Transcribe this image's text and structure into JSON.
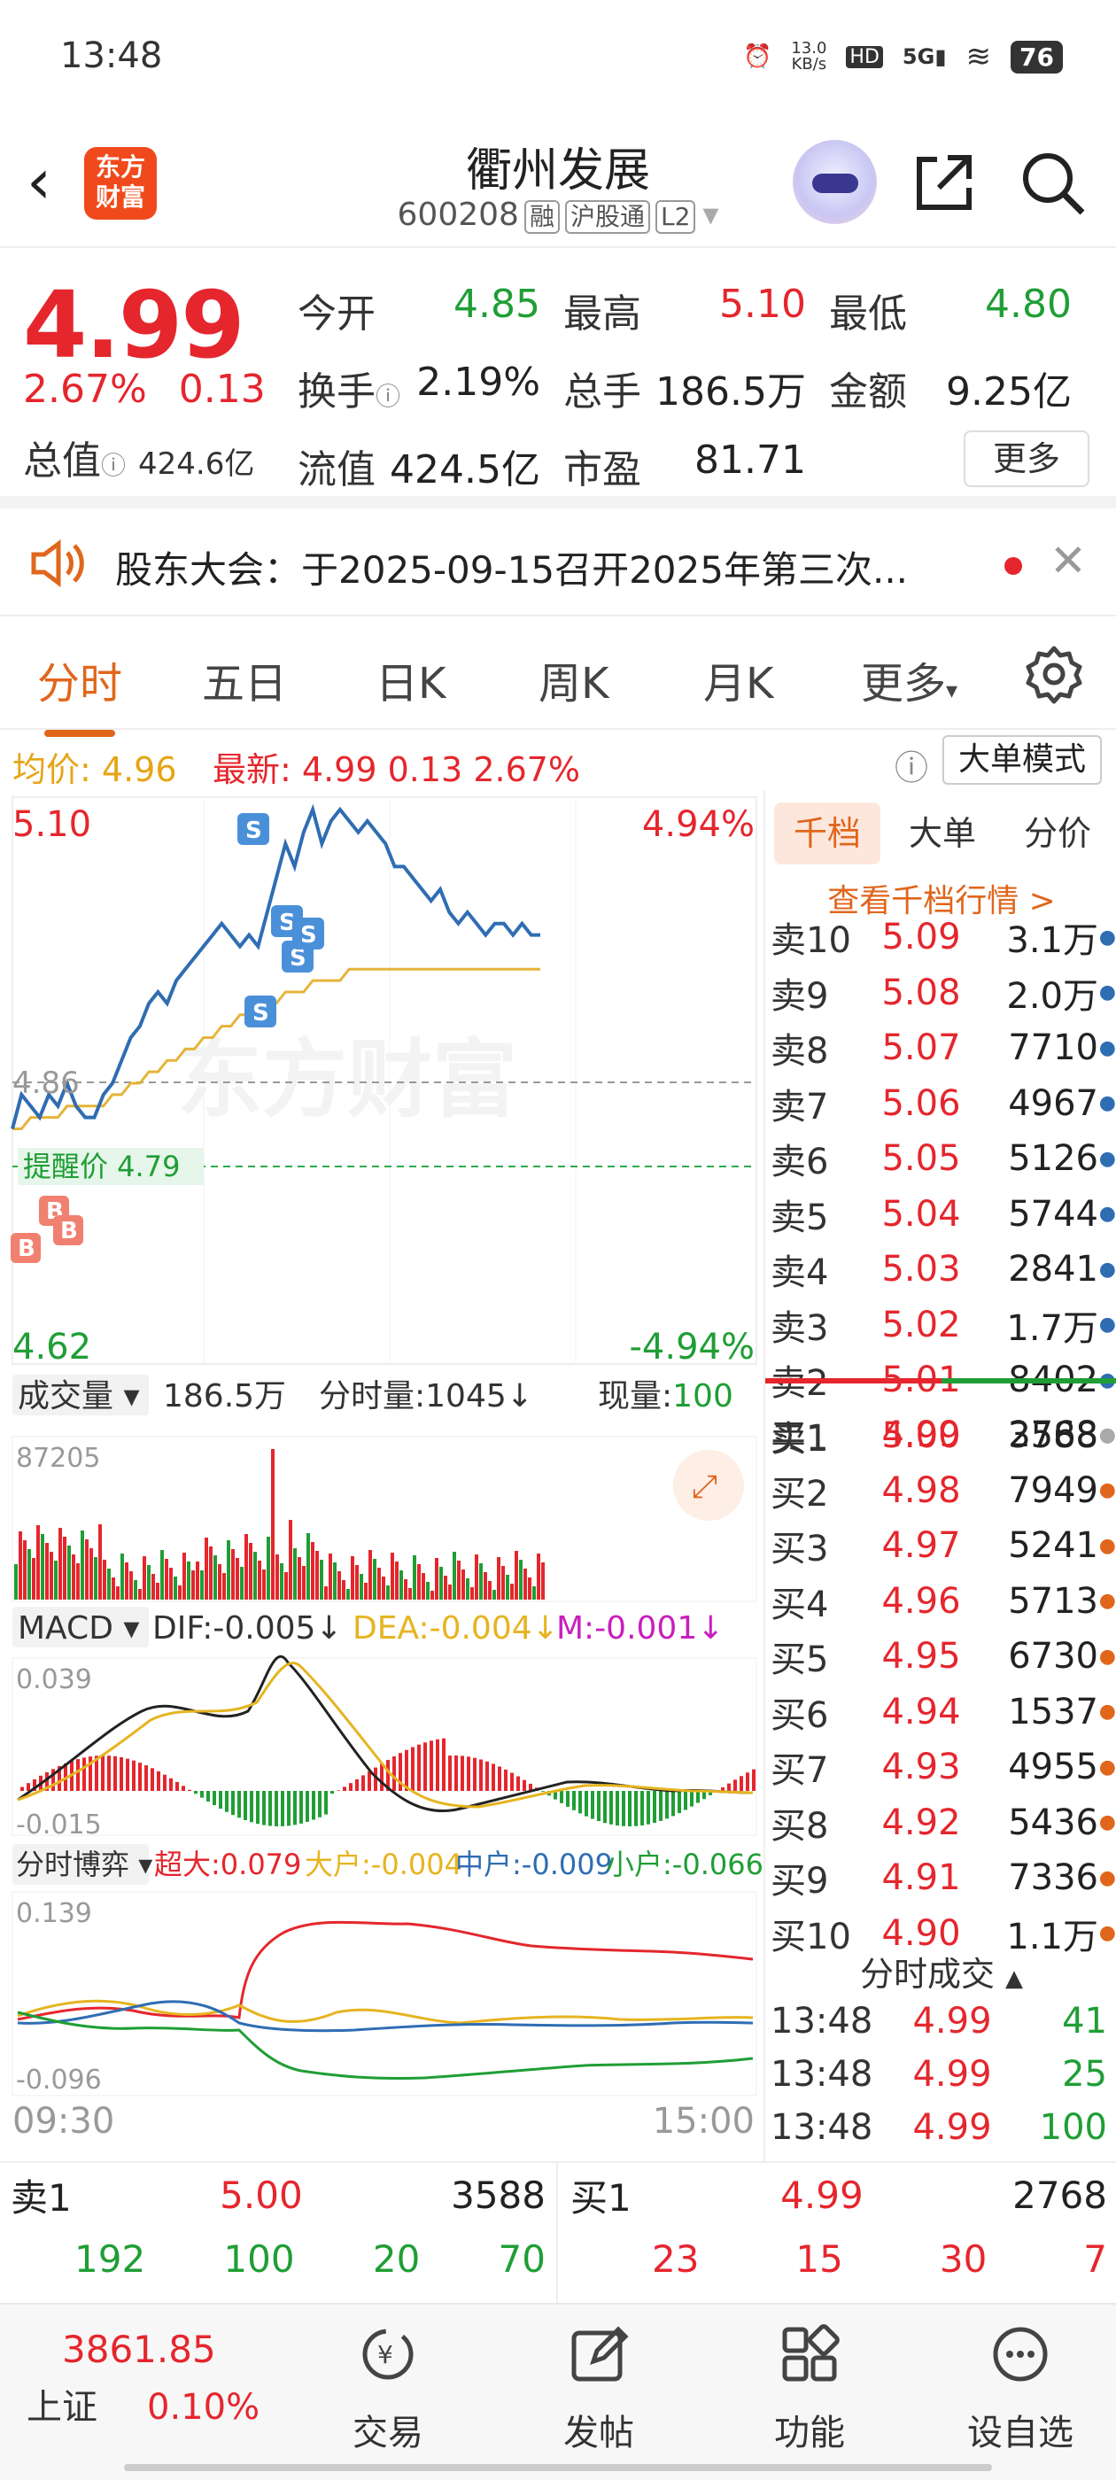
{
  "status": {
    "time": "13:48",
    "speed": "13.0",
    "speed_unit": "KB/s",
    "net": "5G",
    "hd": "HD",
    "battery": "76"
  },
  "header": {
    "logo_line1": "东方",
    "logo_line2": "财富",
    "title": "衢州发展",
    "code": "600208",
    "tags": [
      "融",
      "沪股通",
      "L2"
    ]
  },
  "quote": {
    "price": "4.99",
    "change_pct": "2.67%",
    "change": "0.13",
    "total_mv_label": "总值",
    "total_mv": "424.6亿",
    "rows": [
      [
        {
          "label": "今开",
          "value": "4.85",
          "color": "green"
        },
        {
          "label": "最高",
          "value": "5.10",
          "color": "red"
        },
        {
          "label": "最低",
          "value": "4.80",
          "color": "green"
        }
      ],
      [
        {
          "label": "换手",
          "value": "2.19%",
          "color": "dark"
        },
        {
          "label": "总手",
          "value": "186.5万",
          "color": "dark"
        },
        {
          "label": "金额",
          "value": "9.25亿",
          "color": "dark"
        }
      ],
      [
        {
          "label": "流值",
          "value": "424.5亿",
          "color": "dark"
        },
        {
          "label": "市盈",
          "value": "81.71",
          "color": "dark"
        }
      ]
    ],
    "more_label": "更多"
  },
  "notice": {
    "text": "股东大会：于2025-09-15召开2025年第三次..."
  },
  "tabs": [
    "分时",
    "五日",
    "日K",
    "周K",
    "月K",
    "更多"
  ],
  "infobar": {
    "avg_label": "均价:",
    "avg": "4.96",
    "latest_label": "最新:",
    "latest": "4.99",
    "chg": "0.13",
    "pct": "2.67%",
    "bigorder_label": "大单模式"
  },
  "chart": {
    "price_high": "5.10",
    "price_low": "4.62",
    "pct_high": "4.94%",
    "pct_low": "-4.94%",
    "preclose": "4.86",
    "watermark": "东方财富",
    "alert_label": "提醒价 4.79",
    "vol_label": "成交量",
    "vol_total": "186.5万",
    "vol_seg_label": "分时量:1045↓",
    "vol_now_label": "现量:",
    "vol_now": "100",
    "vol_max": "87205",
    "macd_label": "MACD",
    "dif": "DIF:-0.005↓",
    "dea": "DEA:-0.004↓",
    "m": "M:-0.001↓",
    "macd_top": "0.039",
    "macd_bottom": "-0.015",
    "game_label": "分时博弈",
    "super": "超大:0.079",
    "big": "大户:-0.004",
    "mid": "中户:-0.009",
    "small": "小户:-0.066",
    "game_top": "0.139",
    "game_bottom": "-0.096",
    "t_start": "09:30",
    "t_end": "15:00"
  },
  "chart_data": {
    "type": "line",
    "title": "",
    "price_series": [
      4.82,
      4.85,
      4.84,
      4.83,
      4.85,
      4.84,
      4.86,
      4.84,
      4.83,
      4.83,
      4.85,
      4.86,
      4.88,
      4.9,
      4.91,
      4.93,
      4.94,
      4.93,
      4.95,
      4.96,
      4.97,
      4.98,
      4.99,
      5.0,
      4.99,
      4.98,
      4.99,
      4.98,
      5.01,
      5.04,
      5.07,
      5.05,
      5.08,
      5.1,
      5.07,
      5.09,
      5.1,
      5.09,
      5.08,
      5.09,
      5.08,
      5.07,
      5.05,
      5.05,
      5.04,
      5.03,
      5.02,
      5.03,
      5.01,
      5.0,
      5.01,
      5.0,
      4.99,
      5.0,
      5.0,
      4.99,
      5.0,
      4.99,
      4.99
    ],
    "avg_series": [
      4.82,
      4.82,
      4.83,
      4.83,
      4.83,
      4.83,
      4.84,
      4.84,
      4.84,
      4.84,
      4.84,
      4.85,
      4.85,
      4.86,
      4.86,
      4.87,
      4.87,
      4.88,
      4.88,
      4.89,
      4.89,
      4.9,
      4.9,
      4.91,
      4.91,
      4.92,
      4.92,
      4.92,
      4.93,
      4.93,
      4.94,
      4.94,
      4.94,
      4.95,
      4.95,
      4.95,
      4.95,
      4.96,
      4.96,
      4.96,
      4.96,
      4.96,
      4.96,
      4.96,
      4.96,
      4.96,
      4.96,
      4.96,
      4.96,
      4.96,
      4.96,
      4.96,
      4.96,
      4.96,
      4.96,
      4.96,
      4.96,
      4.96,
      4.96
    ],
    "ylim": [
      4.62,
      5.1
    ],
    "xlabel": "",
    "ylabel": ""
  },
  "orderbook": {
    "tabs": [
      "千档",
      "大单",
      "分价"
    ],
    "link": "查看千档行情 >",
    "sells": [
      {
        "label": "卖10",
        "price": "5.09",
        "vol": "3.1万"
      },
      {
        "label": "卖9",
        "price": "5.08",
        "vol": "2.0万"
      },
      {
        "label": "卖8",
        "price": "5.07",
        "vol": "7710"
      },
      {
        "label": "卖7",
        "price": "5.06",
        "vol": "4967"
      },
      {
        "label": "卖6",
        "price": "5.05",
        "vol": "5126"
      },
      {
        "label": "卖5",
        "price": "5.04",
        "vol": "5744"
      },
      {
        "label": "卖4",
        "price": "5.03",
        "vol": "2841"
      },
      {
        "label": "卖3",
        "price": "5.02",
        "vol": "1.7万"
      },
      {
        "label": "卖2",
        "price": "5.01",
        "vol": "8402"
      },
      {
        "label": "卖1",
        "price": "5.00",
        "vol": "3588"
      }
    ],
    "buys": [
      {
        "label": "买1",
        "price": "4.99",
        "vol": "2768"
      },
      {
        "label": "买2",
        "price": "4.98",
        "vol": "7949"
      },
      {
        "label": "买3",
        "price": "4.97",
        "vol": "5241"
      },
      {
        "label": "买4",
        "price": "4.96",
        "vol": "5713"
      },
      {
        "label": "买5",
        "price": "4.95",
        "vol": "6730"
      },
      {
        "label": "买6",
        "price": "4.94",
        "vol": "1537"
      },
      {
        "label": "买7",
        "price": "4.93",
        "vol": "4955"
      },
      {
        "label": "买8",
        "price": "4.92",
        "vol": "5436"
      },
      {
        "label": "买9",
        "price": "4.91",
        "vol": "7336"
      },
      {
        "label": "买10",
        "price": "4.90",
        "vol": "1.1万"
      }
    ],
    "ticks_label": "分时成交",
    "ticks": [
      {
        "time": "13:48",
        "price": "4.99",
        "vol": "41"
      },
      {
        "time": "13:48",
        "price": "4.99",
        "vol": "25"
      },
      {
        "time": "13:48",
        "price": "4.99",
        "vol": "100"
      }
    ]
  },
  "bottom": {
    "sell_label": "卖1",
    "sell_price": "5.00",
    "sell_vol": "3588",
    "sell_queue": [
      "192",
      "100",
      "20",
      "70"
    ],
    "buy_label": "买1",
    "buy_price": "4.99",
    "buy_vol": "2768",
    "buy_queue": [
      "23",
      "15",
      "30",
      "7"
    ]
  },
  "tabbar": {
    "index_value": "3861.85",
    "index_name": "上证",
    "index_pct": "0.10%",
    "items": [
      "交易",
      "发帖",
      "功能",
      "设自选"
    ]
  }
}
